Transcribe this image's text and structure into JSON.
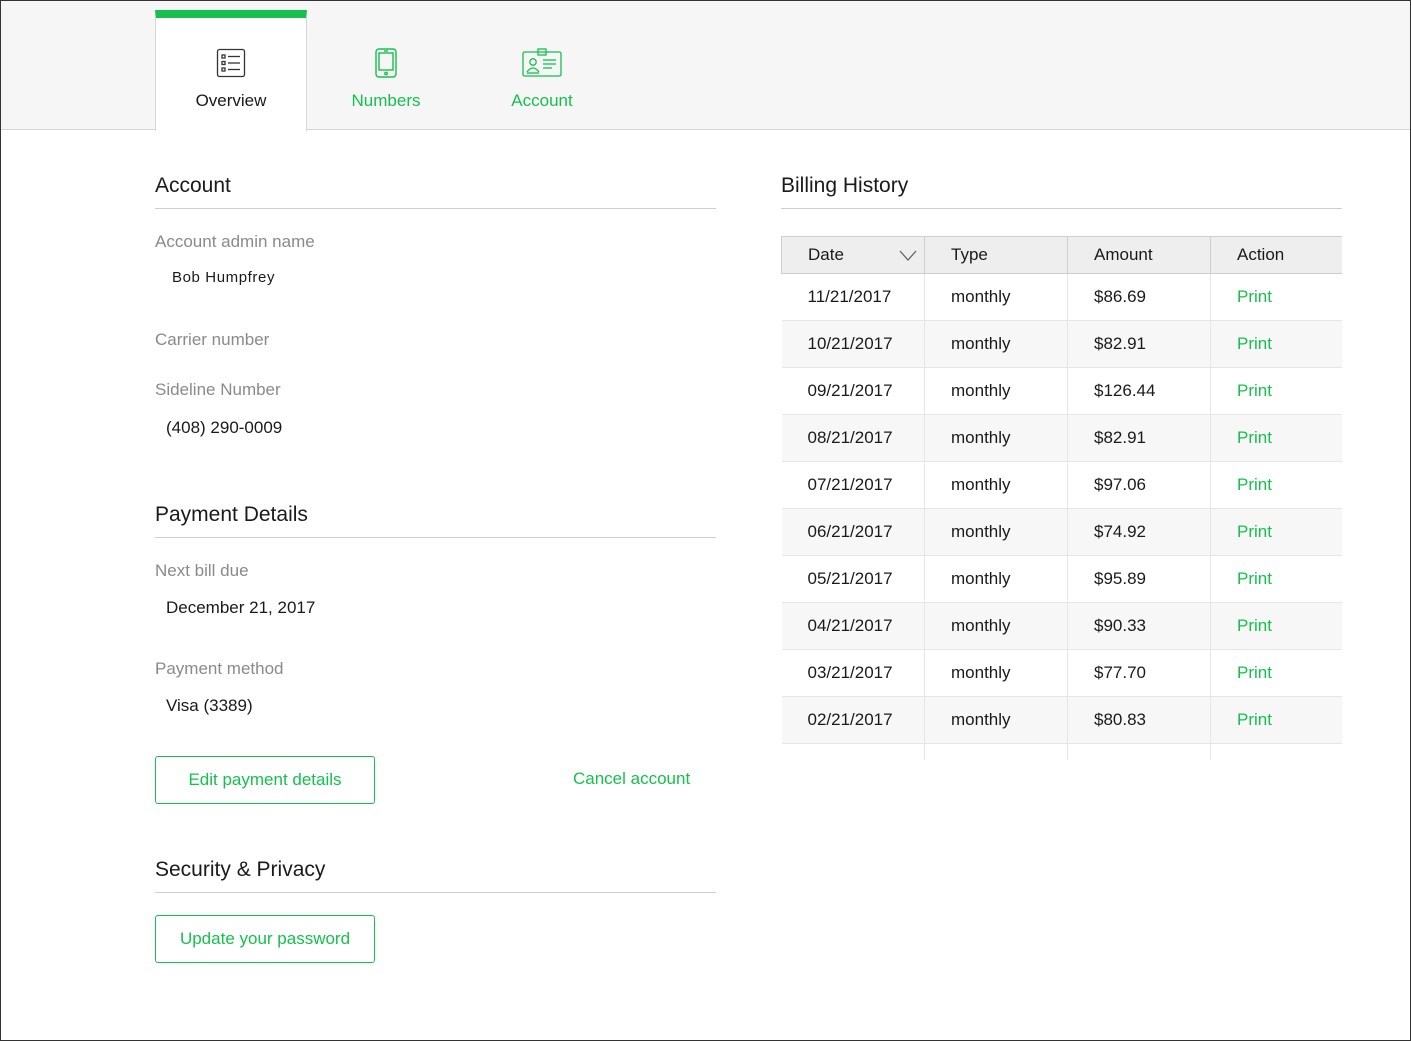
{
  "tabs": [
    {
      "label": "Overview",
      "icon": "list-icon",
      "active": true
    },
    {
      "label": "Numbers",
      "icon": "phone-icon",
      "active": false
    },
    {
      "label": "Account",
      "icon": "id-card-icon",
      "active": false
    }
  ],
  "account": {
    "title": "Account",
    "admin_label": "Account admin name",
    "admin_value": "Bob Humpfrey",
    "carrier_label": "Carrier number",
    "sideline_label": "Sideline Number",
    "sideline_value": "(408) 290-0009"
  },
  "payment": {
    "title": "Payment Details",
    "next_bill_label": "Next bill due",
    "next_bill_value": "December 21, 2017",
    "method_label": "Payment method",
    "method_value": "Visa (3389)",
    "edit_button": "Edit payment details",
    "cancel_link": "Cancel account"
  },
  "security": {
    "title": "Security & Privacy",
    "update_button": "Update your password"
  },
  "billing": {
    "title": "Billing History",
    "columns": [
      "Date",
      "Type",
      "Amount",
      "Action"
    ],
    "rows": [
      {
        "date": "11/21/2017",
        "type": "monthly",
        "amount": "$86.69",
        "action": "Print"
      },
      {
        "date": "10/21/2017",
        "type": "monthly",
        "amount": "$82.91",
        "action": "Print"
      },
      {
        "date": "09/21/2017",
        "type": "monthly",
        "amount": "$126.44",
        "action": "Print"
      },
      {
        "date": "08/21/2017",
        "type": "monthly",
        "amount": "$82.91",
        "action": "Print"
      },
      {
        "date": "07/21/2017",
        "type": "monthly",
        "amount": "$97.06",
        "action": "Print"
      },
      {
        "date": "06/21/2017",
        "type": "monthly",
        "amount": "$74.92",
        "action": "Print"
      },
      {
        "date": "05/21/2017",
        "type": "monthly",
        "amount": "$95.89",
        "action": "Print"
      },
      {
        "date": "04/21/2017",
        "type": "monthly",
        "amount": "$90.33",
        "action": "Print"
      },
      {
        "date": "03/21/2017",
        "type": "monthly",
        "amount": "$77.70",
        "action": "Print"
      },
      {
        "date": "02/21/2017",
        "type": "monthly",
        "amount": "$80.83",
        "action": "Print"
      },
      {
        "date": "",
        "type": "",
        "amount": "",
        "action": ""
      }
    ]
  },
  "colors": {
    "accent": "#16c04e",
    "muted": "#8a8a8a",
    "header_bg": "#f6f6f6"
  }
}
